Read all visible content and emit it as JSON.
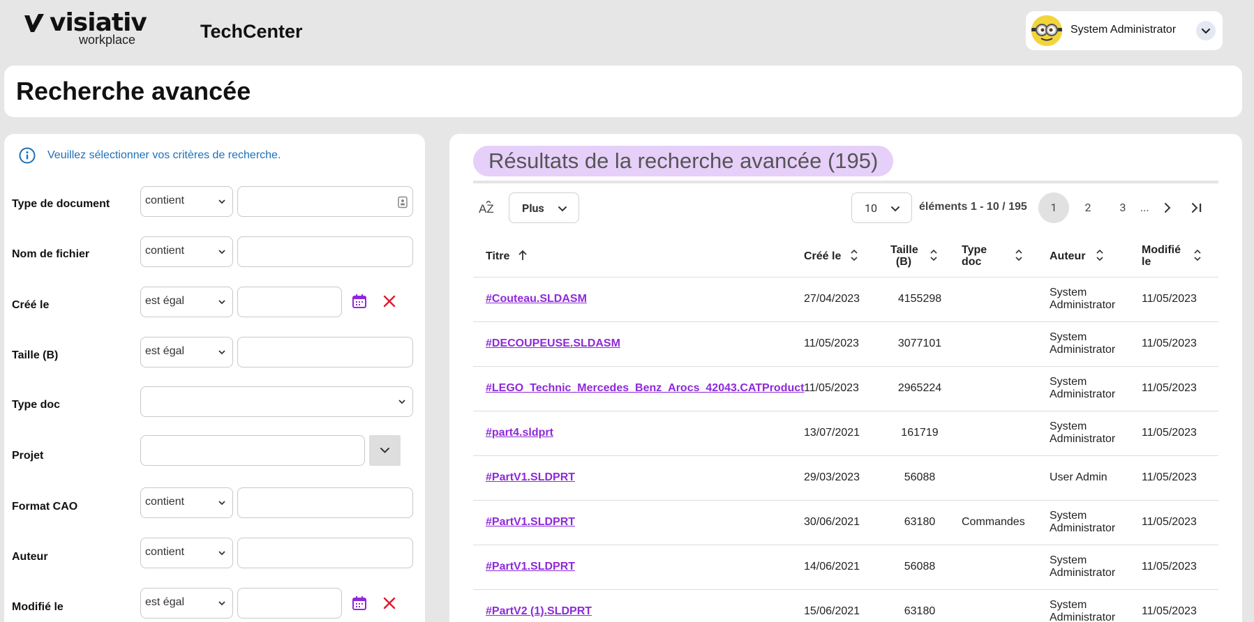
{
  "brand": {
    "name": "visiativ",
    "sub": "workplace",
    "app": "TechCenter"
  },
  "user": {
    "name": "System Administrator",
    "avatar_icon": "minion-avatar"
  },
  "page": {
    "title": "Recherche avancée"
  },
  "criteria": {
    "info": "Veuillez sélectionner vos critères de recherche.",
    "fields": [
      {
        "label": "Type de document",
        "operator": "contient",
        "value": ""
      },
      {
        "label": "Nom de fichier",
        "operator": "contient",
        "value": ""
      },
      {
        "label": "Créé le",
        "operator": "est égal",
        "value": ""
      },
      {
        "label": "Taille (B)",
        "operator": "est égal",
        "value": ""
      },
      {
        "label": "Type doc",
        "operator": "",
        "value": ""
      },
      {
        "label": "Projet",
        "operator": "",
        "value": ""
      },
      {
        "label": "Format CAO",
        "operator": "contient",
        "value": ""
      },
      {
        "label": "Auteur",
        "operator": "contient",
        "value": ""
      },
      {
        "label": "Modifié le",
        "operator": "est égal",
        "value": ""
      }
    ]
  },
  "results": {
    "title": "Résultats de la recherche avancée (195)",
    "az_label": "AZ",
    "more_label": "Plus",
    "page_size": "10",
    "count_label": "éléments 1 - 10 / 195",
    "pages": [
      "1",
      "2",
      "3"
    ],
    "ellipsis": "...",
    "columns": {
      "title": "Titre",
      "created": "Créé le",
      "size_1": "Taille",
      "size_2": "(B)",
      "typedoc_1": "Type",
      "typedoc_2": "doc",
      "author": "Auteur",
      "modified_1": "Modifié",
      "modified_2": "le"
    },
    "rows": [
      {
        "title": "#Couteau.SLDASM",
        "created": "27/04/2023",
        "size": "4155298",
        "typedoc": "",
        "author_1": "System",
        "author_2": "Administrator",
        "modified": "11/05/2023"
      },
      {
        "title": "#DECOUPEUSE.SLDASM",
        "created": "11/05/2023",
        "size": "3077101",
        "typedoc": "",
        "author_1": "System",
        "author_2": "Administrator",
        "modified": "11/05/2023"
      },
      {
        "title": "#LEGO_Technic_Mercedes_Benz_Arocs_42043.CATProduct",
        "created": "11/05/2023",
        "size": "2965224",
        "typedoc": "",
        "author_1": "System",
        "author_2": "Administrator",
        "modified": "11/05/2023"
      },
      {
        "title": "#part4.sldprt",
        "created": "13/07/2021",
        "size": "161719",
        "typedoc": "",
        "author_1": "System",
        "author_2": "Administrator",
        "modified": "11/05/2023"
      },
      {
        "title": "#PartV1.SLDPRT",
        "created": "29/03/2023",
        "size": "56088",
        "typedoc": "",
        "author_1": "User Admin",
        "author_2": "",
        "modified": "11/05/2023"
      },
      {
        "title": "#PartV1.SLDPRT",
        "created": "30/06/2021",
        "size": "63180",
        "typedoc": "Commandes",
        "author_1": "System",
        "author_2": "Administrator",
        "modified": "11/05/2023"
      },
      {
        "title": "#PartV1.SLDPRT",
        "created": "14/06/2021",
        "size": "56088",
        "typedoc": "",
        "author_1": "System",
        "author_2": "Administrator",
        "modified": "11/05/2023"
      },
      {
        "title": "#PartV2 (1).SLDPRT",
        "created": "15/06/2021",
        "size": "63180",
        "typedoc": "",
        "author_1": "System",
        "author_2": "Administrator",
        "modified": "11/05/2023"
      }
    ]
  },
  "colors": {
    "accent": "#8e29d9",
    "pill": "#e6cff9",
    "info": "#1d6fb8",
    "danger": "#e3172c"
  }
}
